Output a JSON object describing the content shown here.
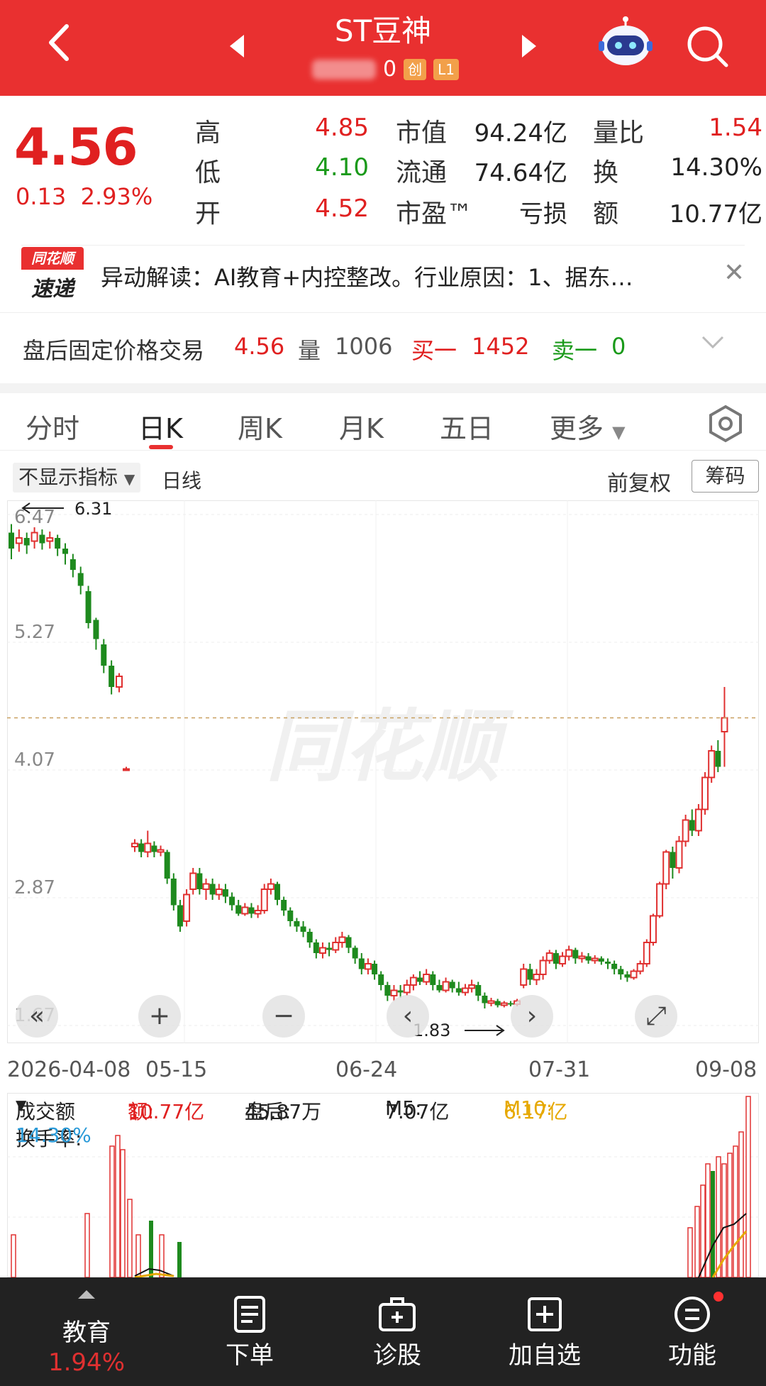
{
  "header": {
    "title": "ST豆神",
    "code_visible": "0",
    "badge_chuang": "创",
    "badge_level": "L1",
    "colors": {
      "bg": "#e93030"
    }
  },
  "quote": {
    "price": "4.56",
    "change": "0.13",
    "change_pct": "2.93%",
    "fields": [
      {
        "label": "高",
        "value": "4.85",
        "color": "red"
      },
      {
        "label": "低",
        "value": "4.10",
        "color": "green"
      },
      {
        "label": "开",
        "value": "4.52",
        "color": "red"
      },
      {
        "label": "市值",
        "value": "94.24亿"
      },
      {
        "label": "流通",
        "value": "74.64亿"
      },
      {
        "label": "市盈™",
        "value": "亏损"
      },
      {
        "label": "量比",
        "value": "1.54",
        "color": "red"
      },
      {
        "label": "换",
        "value": "14.30%"
      },
      {
        "label": "额",
        "value": "10.77亿"
      }
    ]
  },
  "news": {
    "logo_top": "同花顺",
    "logo_bottom": "速递",
    "text": "异动解读：AI教育+内控整改。行业原因：1、据东…"
  },
  "after_hours": {
    "label": "盘后固定价格交易",
    "price": "4.56",
    "vol_label": "量",
    "vol": "1006",
    "buy_label": "买一",
    "buy": "1452",
    "sell_label": "卖一",
    "sell": "0"
  },
  "tabs": [
    "分时",
    "日K",
    "周K",
    "月K",
    "五日",
    "更多"
  ],
  "indicator": {
    "select": "不显示指标",
    "period": "日线",
    "adjust": "前复权",
    "chips": "筹码"
  },
  "chart_data": {
    "type": "candlestick",
    "y_ticks": [
      "6.47",
      "5.27",
      "4.07",
      "2.87",
      "1.67"
    ],
    "ylim": [
      1.67,
      6.47
    ],
    "x_ticks": [
      "2026-04-08",
      "05-15",
      "06-24",
      "07-31",
      "09-08"
    ],
    "max_label": "6.31",
    "min_label": "1.83",
    "watermark": "同花顺",
    "last_price": 4.56,
    "candles": [
      [
        6.3,
        6.15,
        6.38,
        6.05
      ],
      [
        6.2,
        6.25,
        6.33,
        6.12
      ],
      [
        6.25,
        6.18,
        6.3,
        6.1
      ],
      [
        6.22,
        6.3,
        6.35,
        6.15
      ],
      [
        6.28,
        6.2,
        6.33,
        6.14
      ],
      [
        6.22,
        6.25,
        6.31,
        6.15
      ],
      [
        6.25,
        6.15,
        6.28,
        6.08
      ],
      [
        6.15,
        6.1,
        6.2,
        6.0
      ],
      [
        6.05,
        5.95,
        6.1,
        5.88
      ],
      [
        5.92,
        5.8,
        5.98,
        5.72
      ],
      [
        5.75,
        5.45,
        5.8,
        5.4
      ],
      [
        5.48,
        5.3,
        5.5,
        5.2
      ],
      [
        5.25,
        5.05,
        5.3,
        4.98
      ],
      [
        5.05,
        4.85,
        5.1,
        4.78
      ],
      [
        4.85,
        4.95,
        4.98,
        4.8
      ],
      [
        4.08,
        4.08,
        4.1,
        4.06
      ],
      [
        3.35,
        3.38,
        3.42,
        3.3
      ],
      [
        3.38,
        3.3,
        3.42,
        3.25
      ],
      [
        3.3,
        3.38,
        3.5,
        3.25
      ],
      [
        3.36,
        3.3,
        3.4,
        3.25
      ],
      [
        3.3,
        3.32,
        3.36,
        3.26
      ],
      [
        3.3,
        3.05,
        3.32,
        3.0
      ],
      [
        3.05,
        2.8,
        3.1,
        2.75
      ],
      [
        2.8,
        2.6,
        2.85,
        2.55
      ],
      [
        2.65,
        2.9,
        2.95,
        2.6
      ],
      [
        2.95,
        3.1,
        3.15,
        2.9
      ],
      [
        3.1,
        2.95,
        3.15,
        2.9
      ],
      [
        2.95,
        3.0,
        3.05,
        2.85
      ],
      [
        3.0,
        2.9,
        3.05,
        2.85
      ],
      [
        2.9,
        2.95,
        3.0,
        2.85
      ],
      [
        2.95,
        2.88,
        3.0,
        2.82
      ],
      [
        2.88,
        2.8,
        2.92,
        2.75
      ],
      [
        2.8,
        2.72,
        2.85,
        2.7
      ],
      [
        2.72,
        2.78,
        2.82,
        2.7
      ],
      [
        2.78,
        2.72,
        2.82,
        2.68
      ],
      [
        2.72,
        2.75,
        2.8,
        2.68
      ],
      [
        2.75,
        2.95,
        3.0,
        2.72
      ],
      [
        2.95,
        3.0,
        3.05,
        2.9
      ],
      [
        3.0,
        2.85,
        3.02,
        2.8
      ],
      [
        2.85,
        2.75,
        2.88,
        2.7
      ],
      [
        2.75,
        2.65,
        2.78,
        2.6
      ],
      [
        2.65,
        2.6,
        2.68,
        2.55
      ],
      [
        2.6,
        2.55,
        2.65,
        2.5
      ],
      [
        2.55,
        2.45,
        2.58,
        2.4
      ],
      [
        2.45,
        2.35,
        2.48,
        2.3
      ],
      [
        2.35,
        2.4,
        2.45,
        2.3
      ],
      [
        2.4,
        2.38,
        2.45,
        2.32
      ],
      [
        2.38,
        2.45,
        2.5,
        2.35
      ],
      [
        2.45,
        2.5,
        2.55,
        2.4
      ],
      [
        2.5,
        2.4,
        2.52,
        2.35
      ],
      [
        2.4,
        2.3,
        2.42,
        2.25
      ],
      [
        2.3,
        2.2,
        2.35,
        2.15
      ],
      [
        2.2,
        2.25,
        2.3,
        2.15
      ],
      [
        2.25,
        2.15,
        2.28,
        2.1
      ],
      [
        2.15,
        2.05,
        2.18,
        2.0
      ],
      [
        2.05,
        1.95,
        2.08,
        1.9
      ],
      [
        1.95,
        2.0,
        2.05,
        1.9
      ],
      [
        2.0,
        1.98,
        2.05,
        1.93
      ],
      [
        1.98,
        2.05,
        2.1,
        1.95
      ],
      [
        2.05,
        2.12,
        2.15,
        2.0
      ],
      [
        2.12,
        2.08,
        2.18,
        2.05
      ],
      [
        2.08,
        2.15,
        2.2,
        2.05
      ],
      [
        2.15,
        2.05,
        2.18,
        2.0
      ],
      [
        2.05,
        2.0,
        2.1,
        1.98
      ],
      [
        2.0,
        2.08,
        2.12,
        1.98
      ],
      [
        2.08,
        2.02,
        2.1,
        1.98
      ],
      [
        2.02,
        1.98,
        2.08,
        1.95
      ],
      [
        1.98,
        2.02,
        2.06,
        1.95
      ],
      [
        2.02,
        2.05,
        2.1,
        1.98
      ],
      [
        2.05,
        1.95,
        2.08,
        1.9
      ],
      [
        1.95,
        1.88,
        1.98,
        1.83
      ],
      [
        1.88,
        1.9,
        1.93,
        1.85
      ],
      [
        1.9,
        1.86,
        1.92,
        1.84
      ],
      [
        1.86,
        1.88,
        1.9,
        1.84
      ],
      [
        1.88,
        1.87,
        1.9,
        1.85
      ],
      [
        1.87,
        1.9,
        1.92,
        1.85
      ],
      [
        2.05,
        2.2,
        2.25,
        2.02
      ],
      [
        2.2,
        2.1,
        2.25,
        2.05
      ],
      [
        2.1,
        2.15,
        2.2,
        2.05
      ],
      [
        2.15,
        2.28,
        2.32,
        2.1
      ],
      [
        2.28,
        2.35,
        2.38,
        2.25
      ],
      [
        2.35,
        2.25,
        2.38,
        2.2
      ],
      [
        2.25,
        2.32,
        2.36,
        2.22
      ],
      [
        2.32,
        2.38,
        2.42,
        2.28
      ],
      [
        2.38,
        2.3,
        2.4,
        2.25
      ],
      [
        2.3,
        2.32,
        2.36,
        2.26
      ],
      [
        2.32,
        2.28,
        2.35,
        2.25
      ],
      [
        2.28,
        2.3,
        2.33,
        2.25
      ],
      [
        2.3,
        2.27,
        2.32,
        2.24
      ],
      [
        2.27,
        2.25,
        2.3,
        2.2
      ],
      [
        2.25,
        2.2,
        2.28,
        2.15
      ],
      [
        2.2,
        2.15,
        2.23,
        2.1
      ],
      [
        2.15,
        2.12,
        2.18,
        2.08
      ],
      [
        2.12,
        2.18,
        2.2,
        2.1
      ],
      [
        2.18,
        2.25,
        2.28,
        2.15
      ],
      [
        2.25,
        2.45,
        2.48,
        2.22
      ],
      [
        2.45,
        2.7,
        2.72,
        2.42
      ],
      [
        2.7,
        3.0,
        3.02,
        2.68
      ],
      [
        3.0,
        3.3,
        3.32,
        2.95
      ],
      [
        3.3,
        3.15,
        3.35,
        3.05
      ],
      [
        3.15,
        3.4,
        3.45,
        3.1
      ],
      [
        3.4,
        3.6,
        3.65,
        3.35
      ],
      [
        3.6,
        3.5,
        3.7,
        3.45
      ],
      [
        3.5,
        3.7,
        3.75,
        3.45
      ],
      [
        3.7,
        4.0,
        4.05,
        3.65
      ],
      [
        4.0,
        4.25,
        4.3,
        3.95
      ],
      [
        4.25,
        4.1,
        4.35,
        4.05
      ],
      [
        4.43,
        4.56,
        4.85,
        4.1
      ]
    ]
  },
  "volume": {
    "label": "成交额",
    "amount_label": "额:",
    "amount": "10.77亿",
    "after_label": "盘后:",
    "after": "45.87万",
    "m5_label": "M5:",
    "m5": "7.07亿",
    "m10_label": "M10:",
    "m10": "6.17亿",
    "turnover_label": "换手率:",
    "turnover": "14.30%",
    "colors": {
      "m10": "#e6a800",
      "turnover": "#2a9ad8"
    }
  },
  "chart_controls": [
    "rewind-icon",
    "zoom-in-icon",
    "zoom-out-icon",
    "prev-icon",
    "next-icon",
    "fullscreen-icon"
  ],
  "nav": {
    "items": [
      {
        "label": "教育",
        "sub": "1.94%"
      },
      {
        "label": "下单"
      },
      {
        "label": "诊股"
      },
      {
        "label": "加自选"
      },
      {
        "label": "功能"
      }
    ]
  }
}
